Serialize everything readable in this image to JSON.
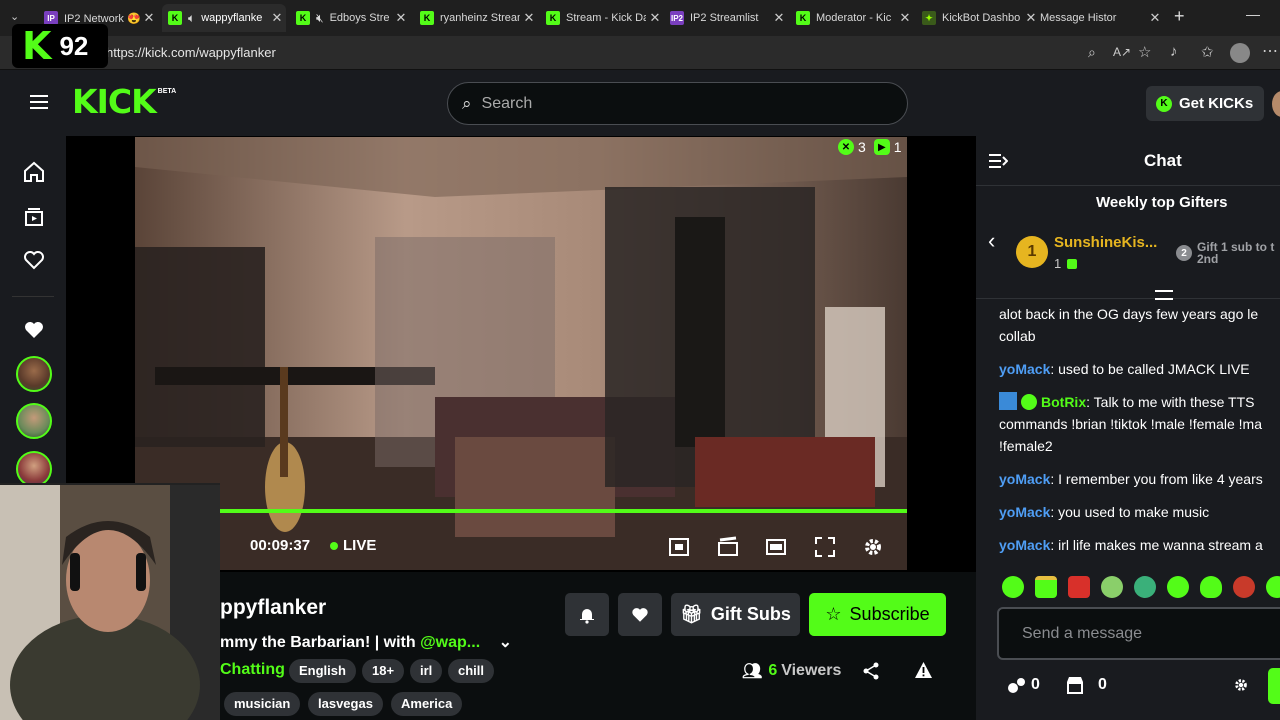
{
  "browser": {
    "tabs": [
      {
        "label": "IP2 Network 😍",
        "icon": "ip2-icon"
      },
      {
        "label": "wappyflanke",
        "icon": "kick-icon",
        "active": true
      },
      {
        "label": "Edboys Stre",
        "icon": "kick-icon"
      },
      {
        "label": "ryanheinz Stream",
        "icon": "kick-icon"
      },
      {
        "label": "Stream - Kick Da",
        "icon": "kick-icon"
      },
      {
        "label": "IP2 Streamlist",
        "icon": "ip2-icon"
      },
      {
        "label": "Moderator - Kic",
        "icon": "kick-icon"
      },
      {
        "label": "KickBot Dashbo",
        "icon": "kickbot-icon"
      },
      {
        "label": "Message Histor",
        "icon": "message-icon"
      }
    ],
    "url": "https://kick.com/wappyflanker"
  },
  "header": {
    "logo": "KICK",
    "logo_badge": "BETA",
    "search_placeholder": "Search",
    "get_kicks_label": "Get KICKs"
  },
  "overlay": {
    "kick_count": "92"
  },
  "player": {
    "stat_kicks": "3",
    "stat_plays": "1",
    "time": "00:09:37",
    "live_label": "LIVE",
    "progress": 1.0
  },
  "channel": {
    "name": "ppyflanker",
    "title": "mmy the Barbarian! | with",
    "mention": "@wap...",
    "category": "Chatting",
    "tags": [
      "English",
      "18+",
      "irl",
      "chill",
      "musician",
      "lasvegas",
      "America"
    ],
    "viewers_count": "6",
    "viewers_label": "Viewers",
    "gift_subs_label": "Gift Subs",
    "subscribe_label": "Subscribe"
  },
  "chat": {
    "title": "Chat",
    "gifters_title": "Weekly top Gifters",
    "gifter1_name": "SunshineKis...",
    "gifter1_rank": "1",
    "gifter1_count": "1",
    "gifter2_rank": "2",
    "gifter2_text": "Gift 1 sub to t",
    "gifter2_place": "2nd",
    "messages": [
      {
        "user": "",
        "text": "alot back in the OG days few years ago le",
        "cont": "collab"
      },
      {
        "user": "yoMack",
        "text": ": used to be called JMACK LIVE"
      },
      {
        "user": "BotRix",
        "text": ": Talk to me with these TTS",
        "cont": "commands !brian !tiktok !male !female !ma",
        "cont2": "!female2"
      },
      {
        "user": "yoMack",
        "text": ": I remember you from like 4 years"
      },
      {
        "user": "yoMack",
        "text": ": you used to make music"
      },
      {
        "user": "yoMack",
        "text": ": irl life makes me wanna stream a"
      }
    ],
    "input_placeholder": "Send a message",
    "footer_count_1": "0",
    "footer_count_2": "0"
  },
  "colors": {
    "accent": "#53fc18",
    "username": "#4f9ef5"
  }
}
